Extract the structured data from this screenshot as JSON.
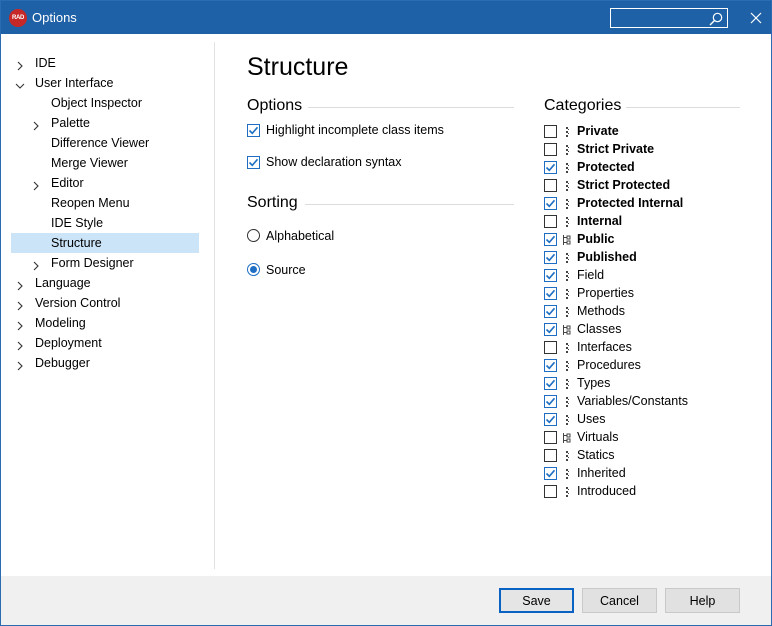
{
  "window": {
    "title": "Options",
    "app_icon_text": "RAD",
    "search_placeholder": ""
  },
  "tree": [
    {
      "label": "IDE",
      "level": 0,
      "expander": "collapsed",
      "selected": false
    },
    {
      "label": "User Interface",
      "level": 0,
      "expander": "expanded",
      "selected": false
    },
    {
      "label": "Object Inspector",
      "level": 1,
      "expander": "none",
      "selected": false
    },
    {
      "label": "Palette",
      "level": 1,
      "expander": "collapsed",
      "selected": false
    },
    {
      "label": "Difference Viewer",
      "level": 1,
      "expander": "none",
      "selected": false
    },
    {
      "label": "Merge Viewer",
      "level": 1,
      "expander": "none",
      "selected": false
    },
    {
      "label": "Editor",
      "level": 1,
      "expander": "collapsed",
      "selected": false
    },
    {
      "label": "Reopen Menu",
      "level": 1,
      "expander": "none",
      "selected": false
    },
    {
      "label": "IDE Style",
      "level": 1,
      "expander": "none",
      "selected": false
    },
    {
      "label": "Structure",
      "level": 1,
      "expander": "none",
      "selected": true
    },
    {
      "label": "Form Designer",
      "level": 1,
      "expander": "collapsed",
      "selected": false
    },
    {
      "label": "Language",
      "level": 0,
      "expander": "collapsed",
      "selected": false
    },
    {
      "label": "Version Control",
      "level": 0,
      "expander": "collapsed",
      "selected": false
    },
    {
      "label": "Modeling",
      "level": 0,
      "expander": "collapsed",
      "selected": false
    },
    {
      "label": "Deployment",
      "level": 0,
      "expander": "collapsed",
      "selected": false
    },
    {
      "label": "Debugger",
      "level": 0,
      "expander": "collapsed",
      "selected": false
    }
  ],
  "page": {
    "title": "Structure",
    "options_heading": "Options",
    "highlight_label": "Highlight incomplete class items",
    "highlight_checked": true,
    "declaration_label": "Show declaration syntax",
    "declaration_checked": true,
    "sorting_heading": "Sorting",
    "alphabetical_label": "Alphabetical",
    "source_label": "Source",
    "sorting_selected": "Source",
    "categories_heading": "Categories"
  },
  "categories": [
    {
      "label": "Private",
      "checked": false,
      "bold": true,
      "icon": "vertical-dots-icon"
    },
    {
      "label": "Strict Private",
      "checked": false,
      "bold": true,
      "icon": "vertical-dots-icon"
    },
    {
      "label": "Protected",
      "checked": true,
      "bold": true,
      "icon": "vertical-dots-icon"
    },
    {
      "label": "Strict Protected",
      "checked": false,
      "bold": true,
      "icon": "vertical-dots-icon"
    },
    {
      "label": "Protected Internal",
      "checked": true,
      "bold": true,
      "icon": "vertical-dots-icon"
    },
    {
      "label": "Internal",
      "checked": false,
      "bold": true,
      "icon": "vertical-dots-icon"
    },
    {
      "label": "Public",
      "checked": true,
      "bold": true,
      "icon": "tree-branch-icon"
    },
    {
      "label": "Published",
      "checked": true,
      "bold": true,
      "icon": "vertical-dots-icon"
    },
    {
      "label": "Field",
      "checked": true,
      "bold": false,
      "icon": "vertical-dots-icon"
    },
    {
      "label": "Properties",
      "checked": true,
      "bold": false,
      "icon": "vertical-dots-icon"
    },
    {
      "label": "Methods",
      "checked": true,
      "bold": false,
      "icon": "vertical-dots-icon"
    },
    {
      "label": "Classes",
      "checked": true,
      "bold": false,
      "icon": "tree-branch-icon"
    },
    {
      "label": "Interfaces",
      "checked": false,
      "bold": false,
      "icon": "vertical-dots-icon"
    },
    {
      "label": "Procedures",
      "checked": true,
      "bold": false,
      "icon": "vertical-dots-icon"
    },
    {
      "label": "Types",
      "checked": true,
      "bold": false,
      "icon": "vertical-dots-icon"
    },
    {
      "label": "Variables/Constants",
      "checked": true,
      "bold": false,
      "icon": "vertical-dots-icon"
    },
    {
      "label": "Uses",
      "checked": true,
      "bold": false,
      "icon": "vertical-dots-icon"
    },
    {
      "label": "Virtuals",
      "checked": false,
      "bold": false,
      "icon": "tree-branch-icon"
    },
    {
      "label": "Statics",
      "checked": false,
      "bold": false,
      "icon": "vertical-dots-icon"
    },
    {
      "label": "Inherited",
      "checked": true,
      "bold": false,
      "icon": "vertical-dots-icon"
    },
    {
      "label": "Introduced",
      "checked": false,
      "bold": false,
      "icon": "vertical-dots-icon"
    }
  ],
  "buttons": {
    "save": "Save",
    "cancel": "Cancel",
    "help": "Help"
  },
  "colors": {
    "titlebar": "#1f61a6",
    "selection": "#cce4f7",
    "accent": "#1e6fc4"
  }
}
